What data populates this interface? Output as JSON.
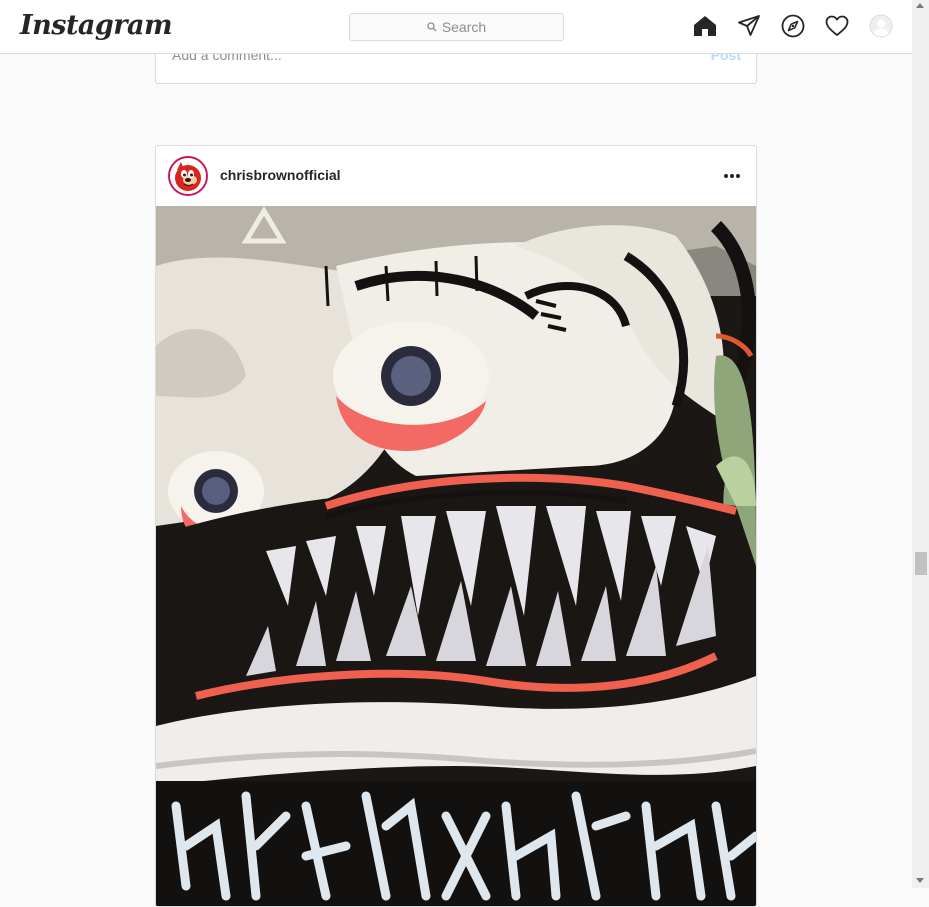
{
  "nav": {
    "logo": "Instagram",
    "search_placeholder": "Search",
    "icons": [
      "home-icon",
      "direct-icon",
      "explore-icon",
      "activity-heart-icon",
      "profile-avatar-icon"
    ]
  },
  "previous_post": {
    "comment_placeholder": "Add a comment...",
    "post_label": "Post"
  },
  "post": {
    "username": "chrisbrownofficial",
    "more_icon": "more-options-icon",
    "image": "graffiti-monster-mural"
  },
  "colors": {
    "border": "#dbdbdb",
    "post_button_disabled": "#b3dbff",
    "avatar_ring": "#c7185c"
  }
}
